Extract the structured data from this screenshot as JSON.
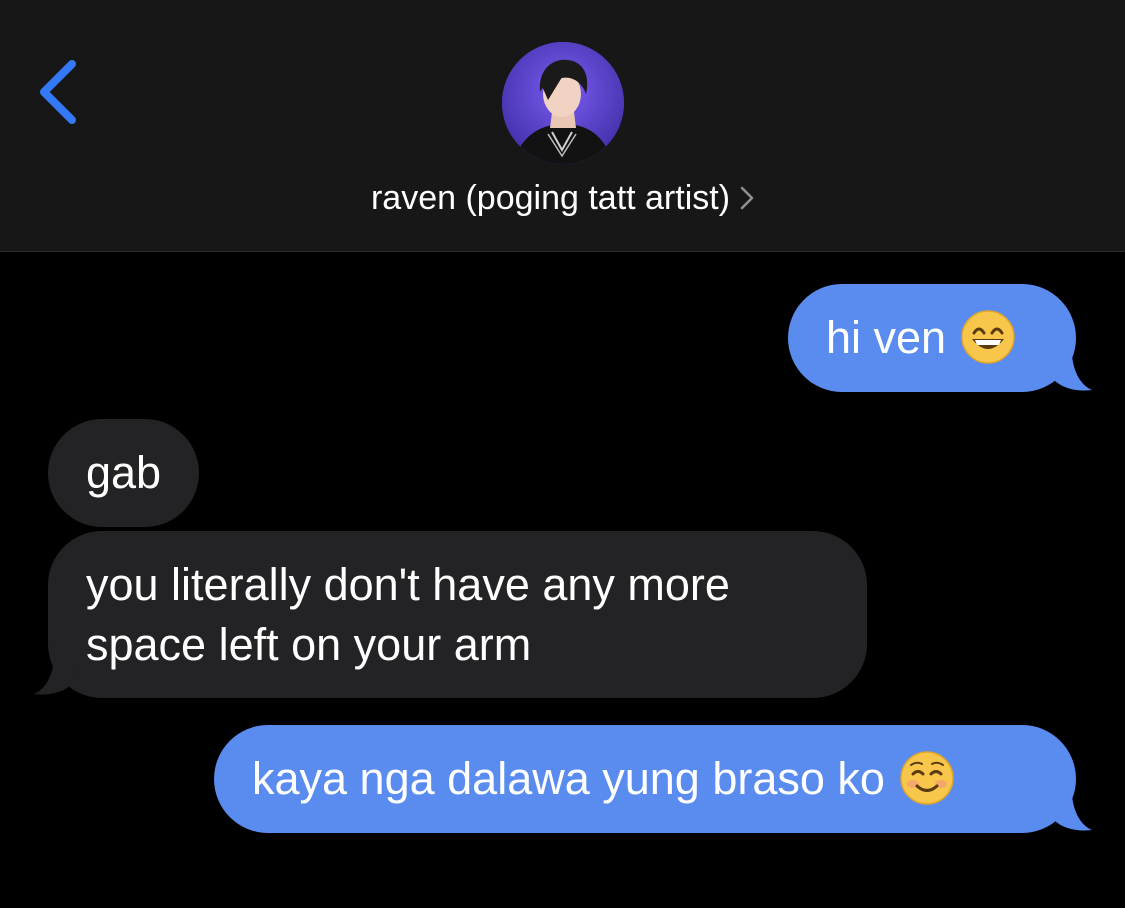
{
  "header": {
    "contact_name": "raven (poging tatt artist)",
    "back_icon": "chevron-left-icon",
    "disclosure_icon": "chevron-right-icon"
  },
  "messages": [
    {
      "from": "me",
      "text": "hi ven",
      "emoji": "grinning-face-with-smiling-eyes"
    },
    {
      "from": "them",
      "text": "gab"
    },
    {
      "from": "them",
      "lines": [
        "you literally don't have any more",
        "space left on your arm"
      ]
    },
    {
      "from": "me",
      "text": "kaya nga dalawa yung braso ko",
      "emoji": "smiling-face"
    }
  ],
  "colors": {
    "accent": "#3478f6",
    "sent_bubble": "#5a8cf0",
    "received_bubble": "#232326",
    "header_bg": "#171717",
    "background": "#000000"
  }
}
